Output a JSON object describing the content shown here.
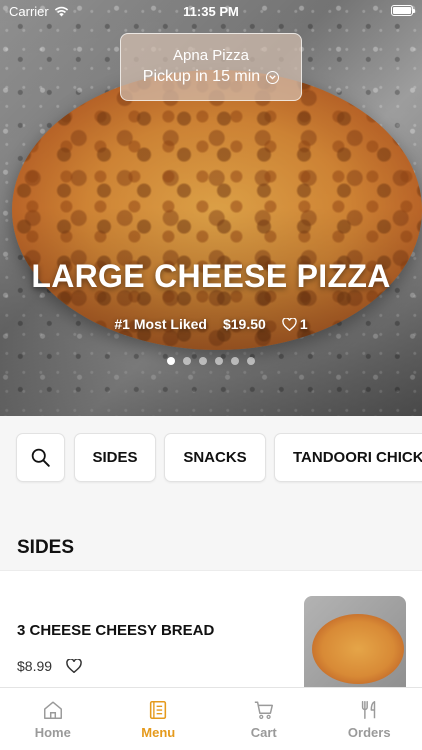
{
  "status_bar": {
    "carrier": "Carrier",
    "time": "11:35 PM"
  },
  "store": {
    "name": "Apna Pizza",
    "pickup": "Pickup in 15 min"
  },
  "hero": {
    "title": "LARGE CHEESE PIZZA",
    "badge": "#1 Most Liked",
    "price": "$19.50",
    "likes": "1",
    "carousel": {
      "total": 6,
      "active": 1
    }
  },
  "categories": {
    "items": [
      "SIDES",
      "SNACKS",
      "TANDOORI CHICKEN"
    ]
  },
  "section": {
    "title": "SIDES"
  },
  "menu_item": {
    "name": "3 CHEESE CHEESY BREAD",
    "price": "$8.99"
  },
  "tabs": [
    {
      "label": "Home",
      "icon": "home-icon"
    },
    {
      "label": "Menu",
      "icon": "menu-book-icon",
      "active": true
    },
    {
      "label": "Cart",
      "icon": "cart-icon"
    },
    {
      "label": "Orders",
      "icon": "fork-knife-icon"
    }
  ],
  "colors": {
    "accent": "#e59a1c",
    "inactive": "#9a9a9a"
  }
}
